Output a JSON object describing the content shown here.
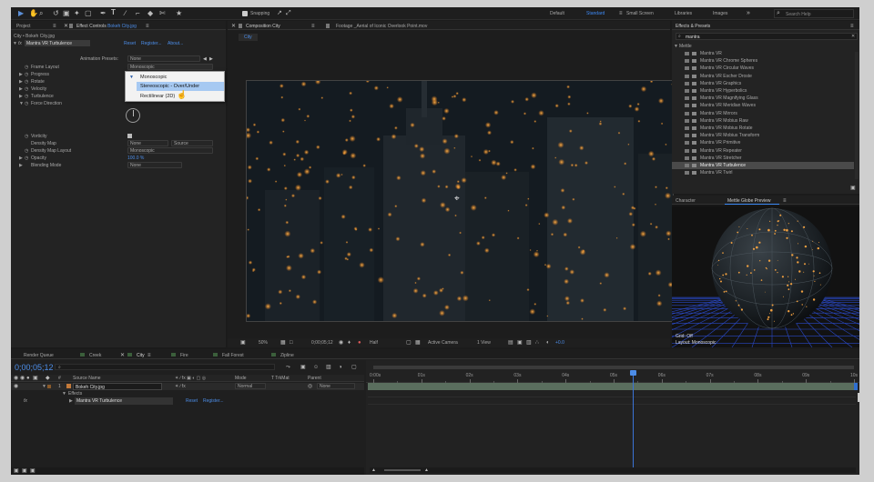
{
  "toolbar": {
    "snapping_label": "Snapping",
    "workspaces": [
      "Default",
      "Standard",
      "Small Screen",
      "Libraries",
      "Images"
    ],
    "active_workspace": "Standard",
    "search_placeholder": "Search Help"
  },
  "project_panel": {
    "tab_project": "Project",
    "tab_effect_controls": "Effect Controls",
    "effect_controls_target": "Bokeh City.jpg",
    "breadcrumb": "City • Bokeh City.jpg",
    "effect_name": "Mantra VR Turbulence",
    "reset_label": "Reset",
    "register_label": "Register...",
    "about_label": "About...",
    "animation_presets_label": "Animation Presets:",
    "animation_presets_value": "None",
    "properties": [
      {
        "label": "Frame Layout",
        "value": "Monoscopic"
      },
      {
        "label": "Progress",
        "value": ""
      },
      {
        "label": "Rotate",
        "value": ""
      },
      {
        "label": "Velocity",
        "value": ""
      },
      {
        "label": "Turbulence",
        "value": ""
      },
      {
        "label": "Force Direction",
        "value": ""
      },
      {
        "label": "Vorticity",
        "value": ""
      },
      {
        "label": "Density Map",
        "value": "None"
      },
      {
        "label": "Density Map Layout",
        "value": "Monoscopic"
      },
      {
        "label": "Opacity",
        "value": "100.0 %"
      },
      {
        "label": "Blending Mode",
        "value": "None"
      }
    ],
    "density_map_source": "Source",
    "frame_layout_options": [
      "Monoscopic",
      "Stereoscopic - Over/Under",
      "Rectilinear (2D)"
    ],
    "frame_layout_highlighted": "Stereoscopic - Over/Under"
  },
  "composition_panel": {
    "tab_composition": "Composition City",
    "tab_footage": "Footage _Aerial of Iconic Overlook Point.mov",
    "comp_tab": "City",
    "zoom": "50%",
    "timecode": "0;00;05;12",
    "resolution": "Half",
    "camera": "Active Camera",
    "views": "1 View",
    "exposure": "+0.0"
  },
  "effects_presets": {
    "title": "Effects & Presets",
    "search_value": "mantra",
    "category": "Mettle",
    "items": [
      "Mantra VR",
      "Mantra VR Chrome Spheres",
      "Mantra VR Circular Waves",
      "Mantra VR Escher Droste",
      "Mantra VR Graphics",
      "Mantra VR Hyperbolics",
      "Mantra VR Magnifying Glass",
      "Mantra VR Meridian Waves",
      "Mantra VR Mirrors",
      "Mantra VR Mobius Raw",
      "Mantra VR Mobius Rotate",
      "Mantra VR Mobius Transform",
      "Mantra VR Primitive",
      "Mantra VR Repeater",
      "Mantra VR Stretcher",
      "Mantra VR Turbulence",
      "Mantra VR Twirl"
    ],
    "selected_index": 15
  },
  "preview_panel": {
    "tab_character": "Character",
    "tab_globe": "Mettle Globe Preview",
    "grid_label": "Grid: Off",
    "layout_label": "Layout: Monoscopic"
  },
  "timeline": {
    "tabs": [
      "Render Queue",
      "Creek",
      "City",
      "Fire",
      "Fall Forest",
      "Zipline"
    ],
    "active_tab": "City",
    "timecode": "0;00;05;12",
    "search_placeholder": "",
    "columns": {
      "source_name": "Source Name",
      "mode": "Mode",
      "trkmat": "T TrkMat",
      "parent": "Parent"
    },
    "layer_number": "1",
    "layer_name": "Bokeh City.jpg",
    "layer_mode": "Normal",
    "layer_parent": "None",
    "effects_label": "Effects",
    "effect_name": "Mantra VR Turbulence",
    "effect_reset": "Reset",
    "effect_register": "Register...",
    "ruler": [
      "0:00s",
      "01s",
      "02s",
      "03s",
      "04s",
      "05s",
      "06s",
      "07s",
      "08s",
      "09s",
      "10s"
    ],
    "playhead_seconds": 5.4,
    "duration_seconds": 10
  },
  "colors": {
    "accent": "#4c8de8",
    "panel_bg": "#232323",
    "dropdown_highlight": "#a6c9f2",
    "layer_bar": "#5a6e5e"
  }
}
